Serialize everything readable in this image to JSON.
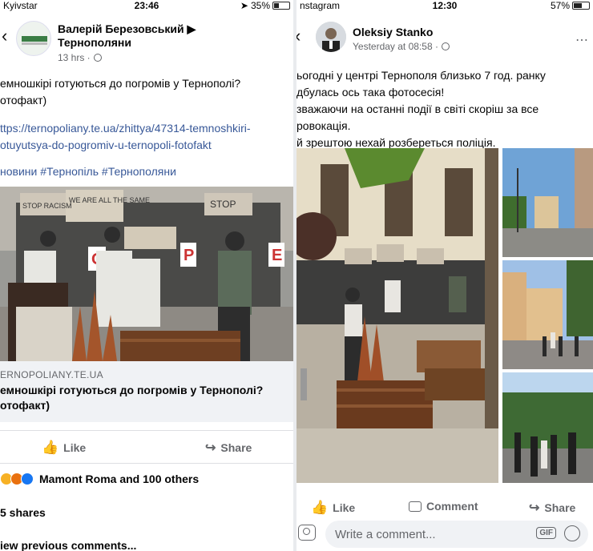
{
  "left": {
    "status": {
      "carrier": "Kyivstar",
      "time": "23:46",
      "battery": "35%",
      "battery_level": 0.35
    },
    "header": {
      "name": "Валерій Березовський ▶ Тернополяни",
      "name_line1": "Валерій Березовський ▶",
      "name_line2": "Тернополяни",
      "time": "13 hrs ·"
    },
    "post": {
      "line1": "емношкірі готуються до погромів у Тернополі?",
      "line2": "отофакт)",
      "link1": "ttps://ternopoliany.te.ua/zhittya/47314-temnoshkiri-",
      "link2": "otuyutsya-do-pogromiv-u-ternopoli-fotofakt",
      "tags": "новини #Тернопіль #Тернополяни"
    },
    "photo_signs": [
      "STOP RACISM",
      "WE ARE ALL THE SAME",
      "STOP"
    ],
    "linkcard": {
      "domain": "ERNOPOLIANY.TE.UA",
      "title1": "емношкірі готуються до погромів у Тернополі?",
      "title2": "отофакт)"
    },
    "actions": {
      "like": "Like",
      "share": "Share"
    },
    "reactions": {
      "text": "Mamont Roma and 100 others"
    },
    "shares": "5 shares",
    "view_previous": "iew previous comments..."
  },
  "right": {
    "status": {
      "carrier": "nstagram",
      "time": "12:30",
      "battery": "57%",
      "battery_level": 0.57
    },
    "header": {
      "name": "Oleksiy Stanko",
      "time": "Yesterday at 08:58 ·"
    },
    "post": {
      "line1": "ьогодні у центрі Тернополя близько 7 год. ранку",
      "line2": "дбулась ось така фотосесія!",
      "line3": "зважаючи на останні події в світі скоріш за все",
      "line4": "ровокація.",
      "line5": "й зрештою нехай розбереться поліція."
    },
    "actions": {
      "like": "Like",
      "comment": "Comment",
      "share": "Share"
    },
    "comment": {
      "placeholder": "Write a comment...",
      "gif": "GIF"
    }
  },
  "colors": {
    "fb_blue": "#1877f2",
    "link": "#385898",
    "meta_grey": "#65676b"
  }
}
